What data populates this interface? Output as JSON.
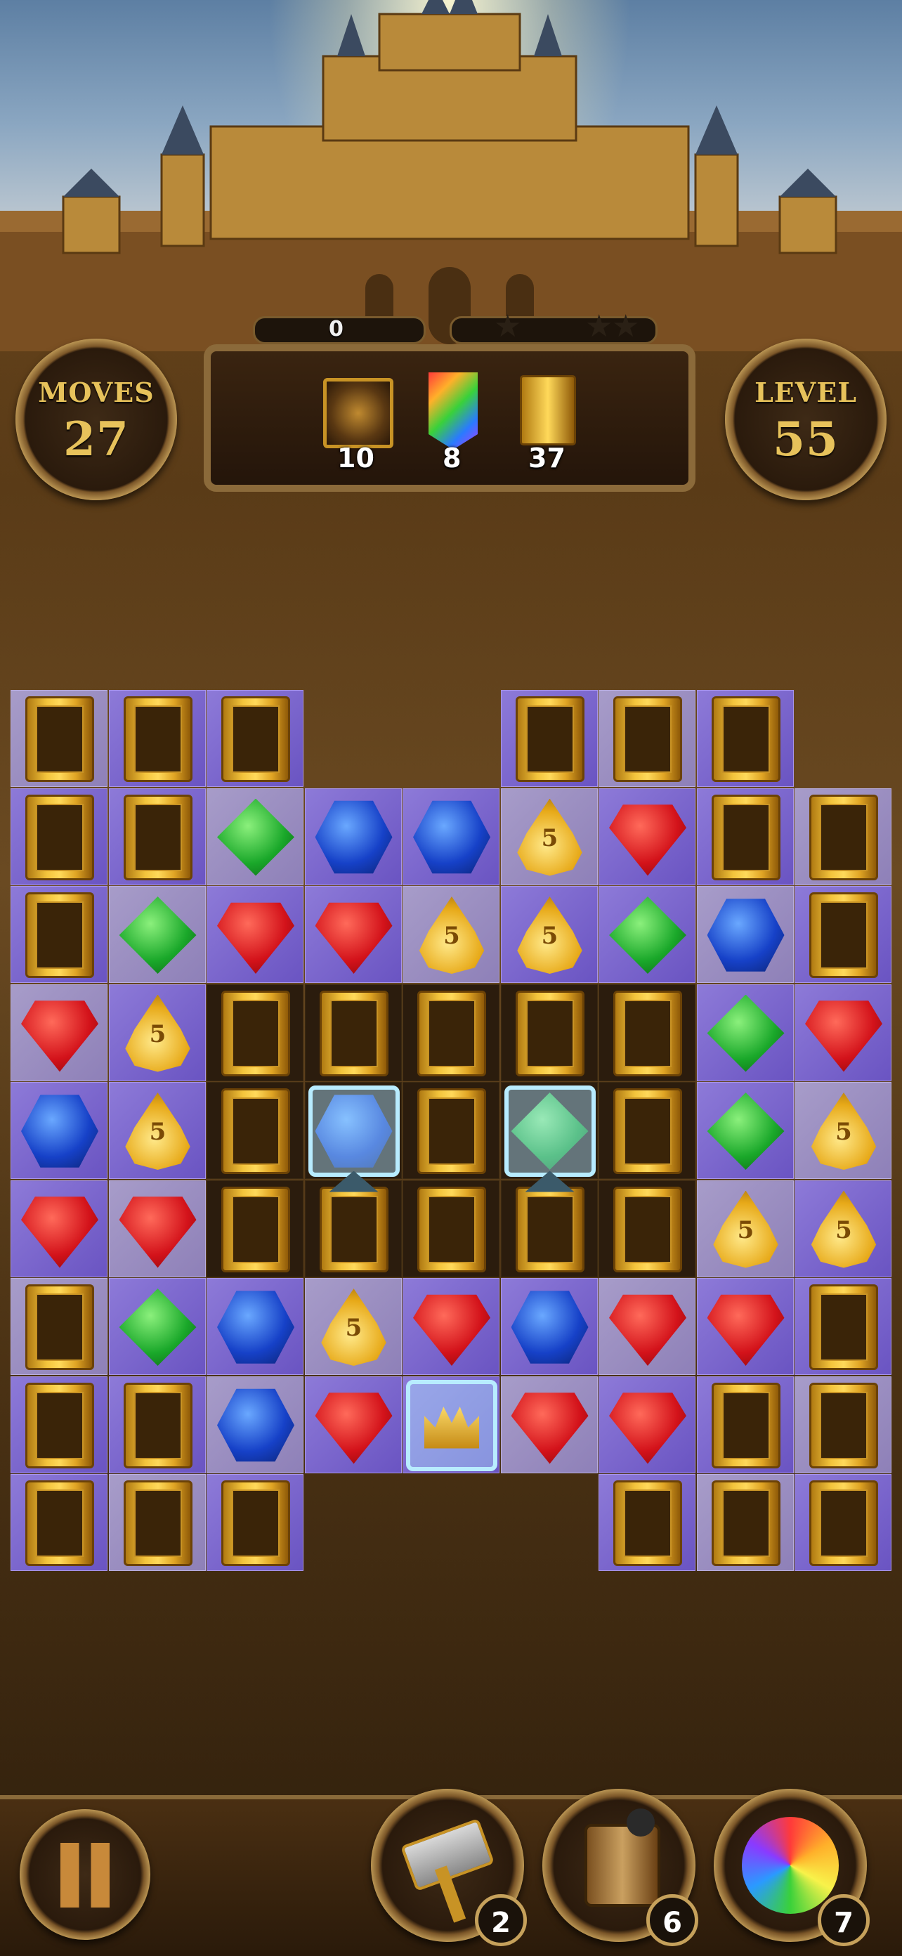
{
  "hud": {
    "moves_label": "MOVES",
    "moves_value": "27",
    "level_label": "LEVEL",
    "level_value": "55",
    "score": "0",
    "stars_earned": 0,
    "stars_total": 3,
    "goals": [
      {
        "icon": "medallion-tile-icon",
        "count": "10"
      },
      {
        "icon": "rainbow-banner-icon",
        "count": "8"
      },
      {
        "icon": "golden-totem-icon",
        "count": "37"
      }
    ]
  },
  "board": {
    "rows": 9,
    "cols": 8,
    "legend": {
      "T": "golden-totem",
      "R": "red-gem",
      "G": "green-gem",
      "B": "blue-gem",
      "Y": "yellow-gem",
      "IB": "frozen-blue-gem",
      "IG": "frozen-green-gem",
      "C": "frozen-crown",
      "TL": "totem-with-lid",
      "-": "empty"
    },
    "grid": [
      [
        "T",
        "T",
        "T",
        "-",
        "-",
        "T",
        "T",
        "T"
      ],
      [
        "T",
        "T",
        "G",
        "B",
        "B",
        "Y",
        "R",
        "T",
        "T"
      ],
      [
        "T",
        "G",
        "R",
        "R",
        "Y",
        "Y",
        "G",
        "B",
        "T"
      ],
      [
        "R",
        "Y",
        "T",
        "T",
        "T",
        "T",
        "T",
        "G",
        "R"
      ],
      [
        "B",
        "Y",
        "T",
        "IB",
        "T",
        "IG",
        "T",
        "G",
        "Y"
      ],
      [
        "R",
        "R",
        "T",
        "TL",
        "T",
        "TL",
        "T",
        "Y",
        "Y"
      ],
      [
        "T",
        "G",
        "B",
        "Y",
        "R",
        "B",
        "R",
        "R",
        "T"
      ],
      [
        "T",
        "T",
        "B",
        "R",
        "C",
        "R",
        "R",
        "T",
        "T"
      ],
      [
        "T",
        "T",
        "T",
        "-",
        "-",
        "-",
        "T",
        "T",
        "T"
      ]
    ],
    "gem_labels": {
      "Y": "5"
    }
  },
  "boosters": [
    {
      "name": "hammer-booster",
      "count": "2"
    },
    {
      "name": "bomb-totem-booster",
      "count": "6"
    },
    {
      "name": "rainbow-orb-booster",
      "count": "7"
    }
  ],
  "colors": {
    "gold": "#e7c25b",
    "purple_cell": "#7c68cf",
    "wood": "#5a3b17"
  }
}
